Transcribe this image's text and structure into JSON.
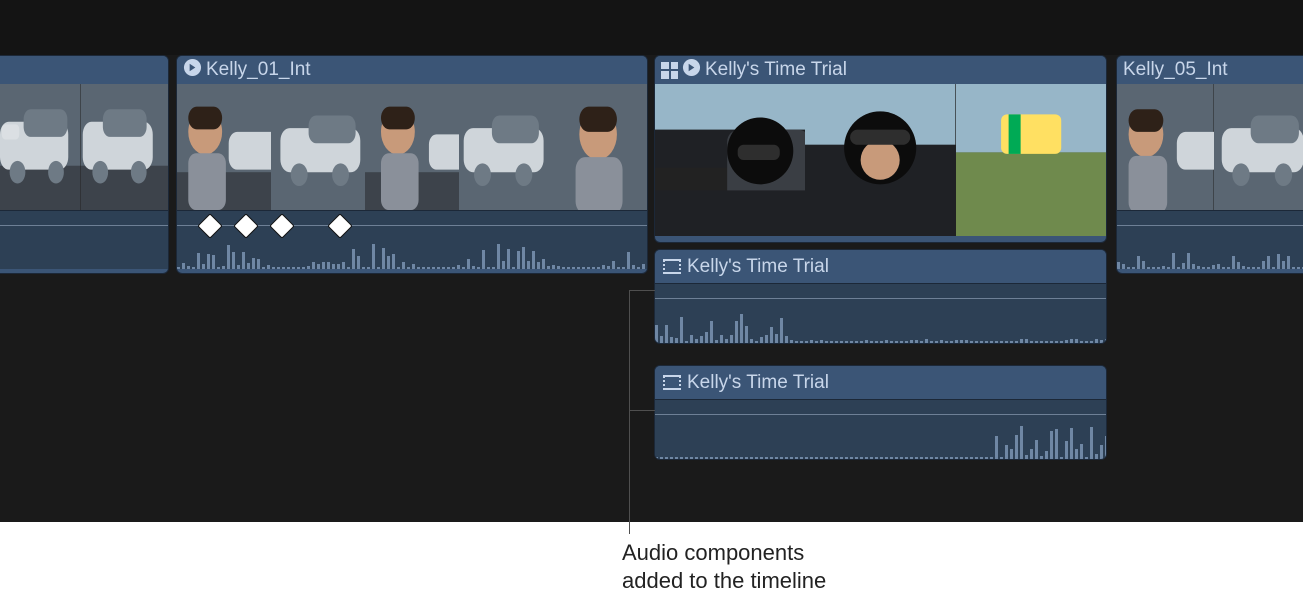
{
  "colors": {
    "clip": "#3b5576",
    "text": "#c8d6ea"
  },
  "clips": {
    "c0": {},
    "c1": {
      "label": "Kelly_01_Int",
      "icon": "multicam-angle"
    },
    "c2": {
      "label": "Kelly's Time Trial",
      "icons": [
        "multicam",
        "multicam-angle"
      ]
    },
    "c3": {
      "label": "Kelly_05_Int"
    }
  },
  "secondary": {
    "s1": {
      "label": "Kelly's Time Trial"
    },
    "s2": {
      "label": "Kelly's Time Trial"
    }
  },
  "annotation": {
    "line1": "Audio components",
    "line2": "added to the timeline"
  }
}
